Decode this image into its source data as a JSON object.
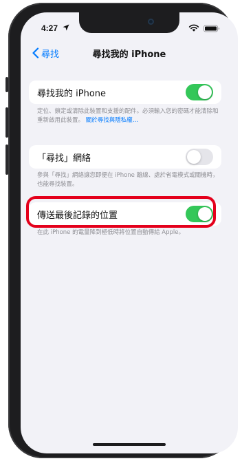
{
  "status_bar": {
    "time": "4:27"
  },
  "nav": {
    "back_label": "尋找",
    "title": "尋找我的 iPhone"
  },
  "settings": {
    "find_my_iphone": {
      "label": "尋找我的 iPhone",
      "enabled": true,
      "footer_text": "定位、鎖定或清除此裝置和支援的配件。必須輸入您的密碼才能清除和重新啟用此裝置。",
      "footer_link": "關於尋找與隱私權…"
    },
    "find_my_network": {
      "label": "「尋找」網絡",
      "enabled": false,
      "footer_text": "參與「尋找」網絡讓您即便在 iPhone 離線、處於省電模式或關機時，也能尋找裝置。"
    },
    "send_last_location": {
      "label": "傳送最後記錄的位置",
      "enabled": true,
      "footer_text": "在此 iPhone 的電量降到極低時將位置自動傳給 Apple。"
    }
  },
  "colors": {
    "accent": "#007aff",
    "toggle_on": "#34c759",
    "toggle_off": "#e5e5ea",
    "highlight": "#e4001b",
    "screen_bg": "#f2f2f7"
  }
}
